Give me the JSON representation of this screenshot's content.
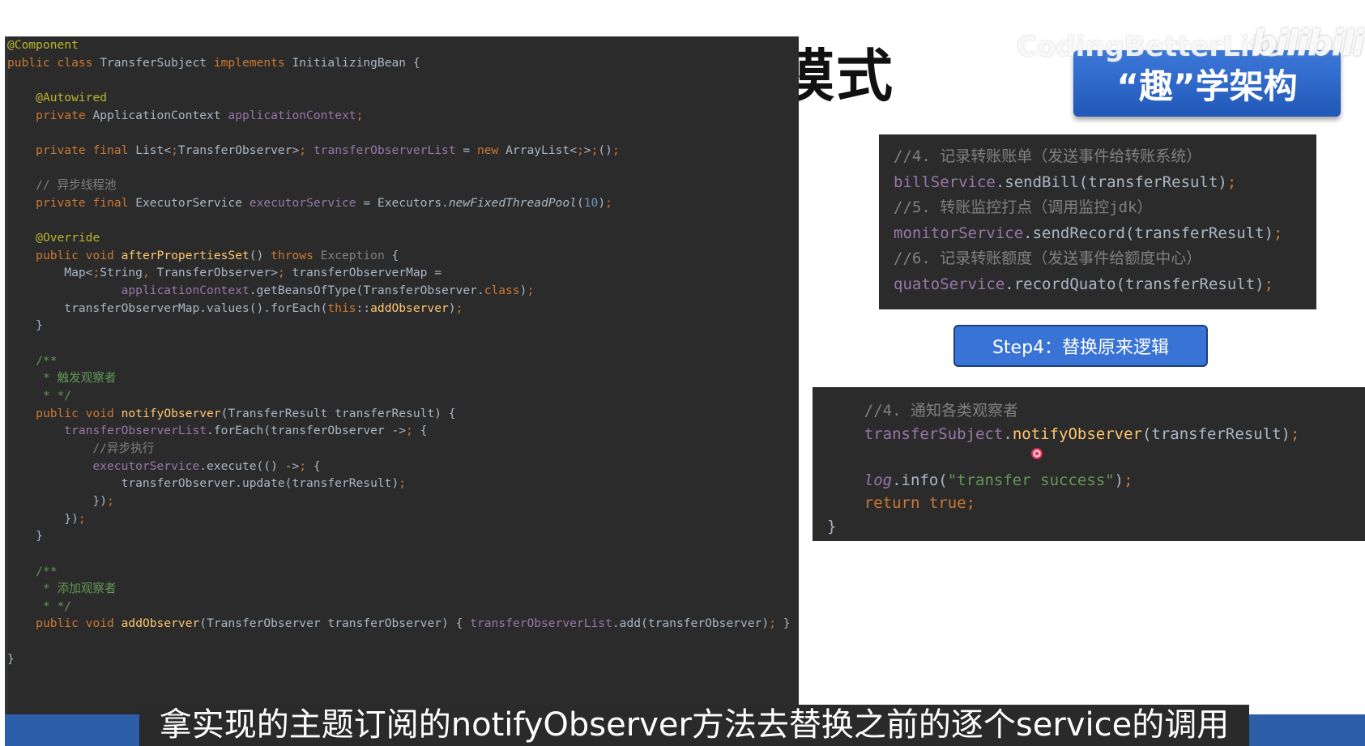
{
  "slide": {
    "title_fragment": "模式",
    "watermark": "CodingBetterLife",
    "site_logo": "bilibili",
    "brand_label": "“趣”学架构"
  },
  "editor": {
    "lines": [
      "@Component",
      "public class TransferSubject implements InitializingBean {",
      "",
      "    @Autowired",
      "    private ApplicationContext applicationContext;",
      "",
      "    private final List<TransferObserver> transferObserverList = new ArrayList<>();",
      "",
      "    // 异步线程池",
      "    private final ExecutorService executorService = Executors.newFixedThreadPool(10);",
      "",
      "    @Override",
      "    public void afterPropertiesSet() throws Exception {",
      "        Map<String, TransferObserver> transferObserverMap =",
      "                applicationContext.getBeansOfType(TransferObserver.class);",
      "        transferObserverMap.values().forEach(this::addObserver);",
      "    }",
      "",
      "    /**",
      "     * 触发观察者",
      "     * */",
      "    public void notifyObserver(TransferResult transferResult) {",
      "        transferObserverList.forEach(transferObserver -> {",
      "            //异步执行",
      "            executorService.execute(() -> {",
      "                transferObserver.update(transferResult);",
      "            });",
      "        });",
      "    }",
      "",
      "    /**",
      "     * 添加观察者",
      "     * */",
      "    public void addObserver(TransferObserver transferObserver) { transferObserverList.add(transferObserver); }",
      "",
      "}"
    ]
  },
  "code_before": {
    "lines": [
      "//4. 记录转账账单（发送事件给转账系统）",
      "billService.sendBill(transferResult);",
      "//5. 转账监控打点（调用监控jdk）",
      "monitorService.sendRecord(transferResult);",
      "//6. 记录转账额度（发送事件给额度中心）",
      "quatoService.recordQuato(transferResult);"
    ]
  },
  "step_button": {
    "label": "Step4：替换原来逻辑"
  },
  "code_after": {
    "lines": [
      "    //4. 通知各类观察者",
      "    transferSubject.notifyObserver(transferResult);",
      "",
      "    log.info(\"transfer success\");",
      "    return true;",
      "}"
    ]
  },
  "subtitle": "拿实现的主题订阅的notifyObserver方法去替换之前的逐个service的调用",
  "colors": {
    "code_bg": "#2b2b2b",
    "keyword": "#cc7832",
    "annotation": "#bbb529",
    "field": "#9876aa",
    "method_decl": "#ffc66d",
    "comment": "#808080",
    "doc_comment": "#629755",
    "number": "#6897bb",
    "text": "#a9b7c6",
    "brand_blue": "#2d5ea8",
    "button_blue": "#3a73d6"
  }
}
